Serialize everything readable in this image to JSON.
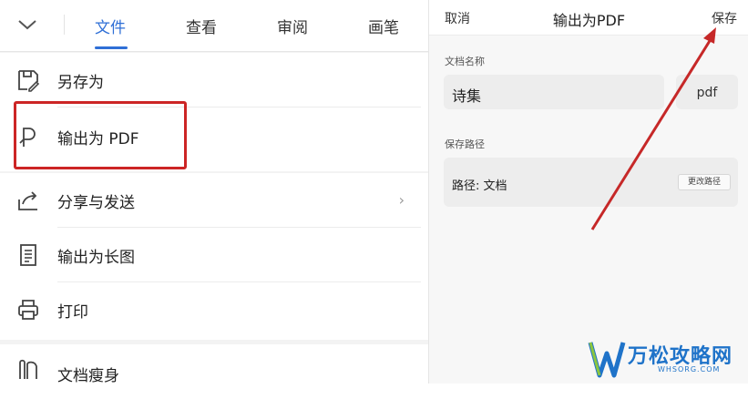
{
  "tabs": [
    {
      "label": "文件",
      "active": true
    },
    {
      "label": "查看"
    },
    {
      "label": "审阅"
    },
    {
      "label": "画笔"
    }
  ],
  "menu": {
    "items": [
      {
        "label": "另存为",
        "icon": "save-as-icon"
      },
      {
        "label": "输出为 PDF",
        "icon": "pdf-icon"
      },
      {
        "label": "分享与发送",
        "icon": "share-icon"
      },
      {
        "label": "输出为长图",
        "icon": "long-image-icon"
      },
      {
        "label": "打印",
        "icon": "print-icon"
      },
      {
        "label": "文档瘦身",
        "icon": "slim-icon"
      }
    ]
  },
  "dialog": {
    "cancel": "取消",
    "title": "输出为PDF",
    "save": "保存",
    "name_section": "文档名称",
    "name_value": "诗集",
    "extension": "pdf",
    "path_section": "保存路径",
    "path_label": "路径: 文档",
    "change_path": "更改路径"
  },
  "watermark": {
    "title": "万松攻略网",
    "sub": "WHSORG.COM"
  },
  "colors": {
    "accent": "#2f6fd6",
    "highlight": "#cc2525",
    "watermark": "#1f73c9"
  }
}
